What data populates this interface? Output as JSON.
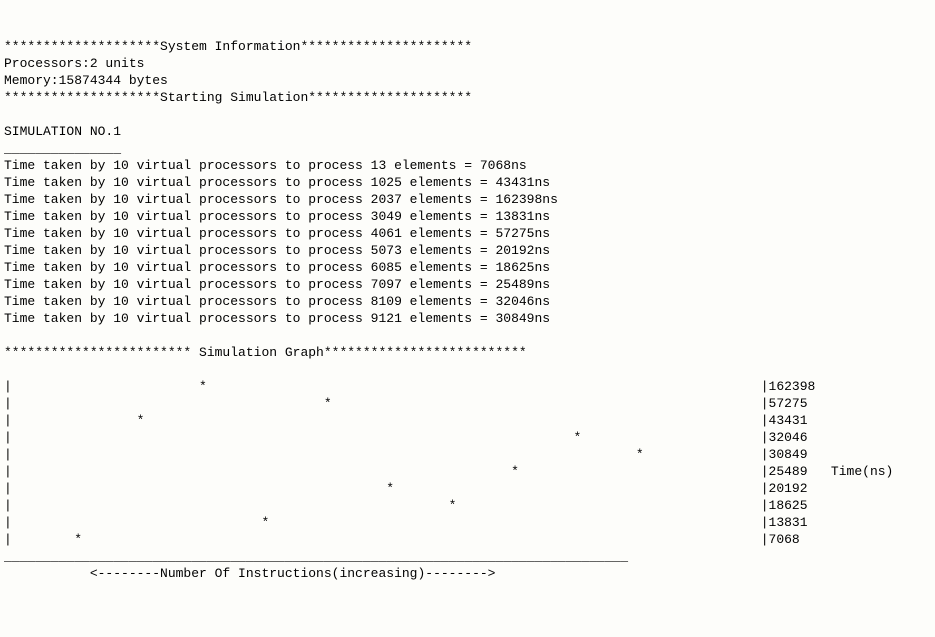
{
  "header": {
    "sysinfo_line": "********************System Information**********************",
    "processors_line": "Processors:2 units",
    "memory_line": "Memory:15874344 bytes",
    "starting_line": "********************Starting Simulation*********************"
  },
  "simulation": {
    "title": "SIMULATION NO.1",
    "underline": "_______________",
    "lines": [
      "Time taken by 10 virtual processors to process 13 elements = 7068ns",
      "Time taken by 10 virtual processors to process 1025 elements = 43431ns",
      "Time taken by 10 virtual processors to process 2037 elements = 162398ns",
      "Time taken by 10 virtual processors to process 3049 elements = 13831ns",
      "Time taken by 10 virtual processors to process 4061 elements = 57275ns",
      "Time taken by 10 virtual processors to process 5073 elements = 20192ns",
      "Time taken by 10 virtual processors to process 6085 elements = 18625ns",
      "Time taken by 10 virtual processors to process 7097 elements = 25489ns",
      "Time taken by 10 virtual processors to process 8109 elements = 32046ns",
      "Time taken by 10 virtual processors to process 9121 elements = 30849ns"
    ]
  },
  "graph": {
    "title": "************************ Simulation Graph**************************",
    "rows": [
      "|                        *                                                                       |162398",
      "|                                        *                                                       |57275",
      "|                *                                                                               |43431",
      "|                                                                        *                       |32046",
      "|                                                                                *               |30849",
      "|                                                                *                               |25489   Time(ns)",
      "|                                                *                                               |20192",
      "|                                                        *                                       |18625",
      "|                                *                                                               |13831",
      "|        *                                                                                       |7068"
    ],
    "baseline": "________________________________________________________________________________",
    "axis_label": "           <--------Number Of Instructions(increasing)-------->"
  },
  "chart_data": {
    "type": "scatter",
    "title": "Simulation Graph",
    "xlabel": "Number Of Instructions (increasing)",
    "ylabel": "Time(ns)",
    "x": [
      13,
      1025,
      2037,
      3049,
      4061,
      5073,
      6085,
      7097,
      8109,
      9121
    ],
    "values": [
      7068,
      43431,
      162398,
      13831,
      57275,
      20192,
      18625,
      25489,
      32046,
      30849
    ],
    "ylim": [
      7068,
      162398
    ]
  }
}
